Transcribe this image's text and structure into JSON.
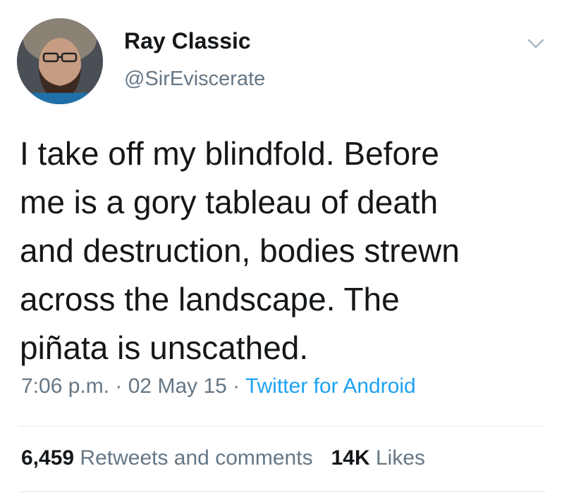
{
  "user": {
    "display_name": "Ray Classic",
    "handle": "@SirEviscerate",
    "avatar_icon": "profile-photo"
  },
  "menu_icon": "chevron-down-icon",
  "tweet": {
    "lines": [
      "I take off my blindfold. Before",
      "me is a gory tableau of death",
      "and destruction, bodies strewn",
      "across the landscape. The",
      "piñata is unscathed."
    ]
  },
  "meta": {
    "time": "7:06 p.m.",
    "separator": " · ",
    "date": "02 May 15",
    "source": "Twitter for Android"
  },
  "stats": {
    "retweets_count": "6,459",
    "retweets_label": "Retweets and comments",
    "likes_count": "14K",
    "likes_label": "Likes"
  },
  "colors": {
    "text": "#14171a",
    "secondary": "#657786",
    "link": "#1da1f2",
    "divider": "#e1e8ed"
  }
}
